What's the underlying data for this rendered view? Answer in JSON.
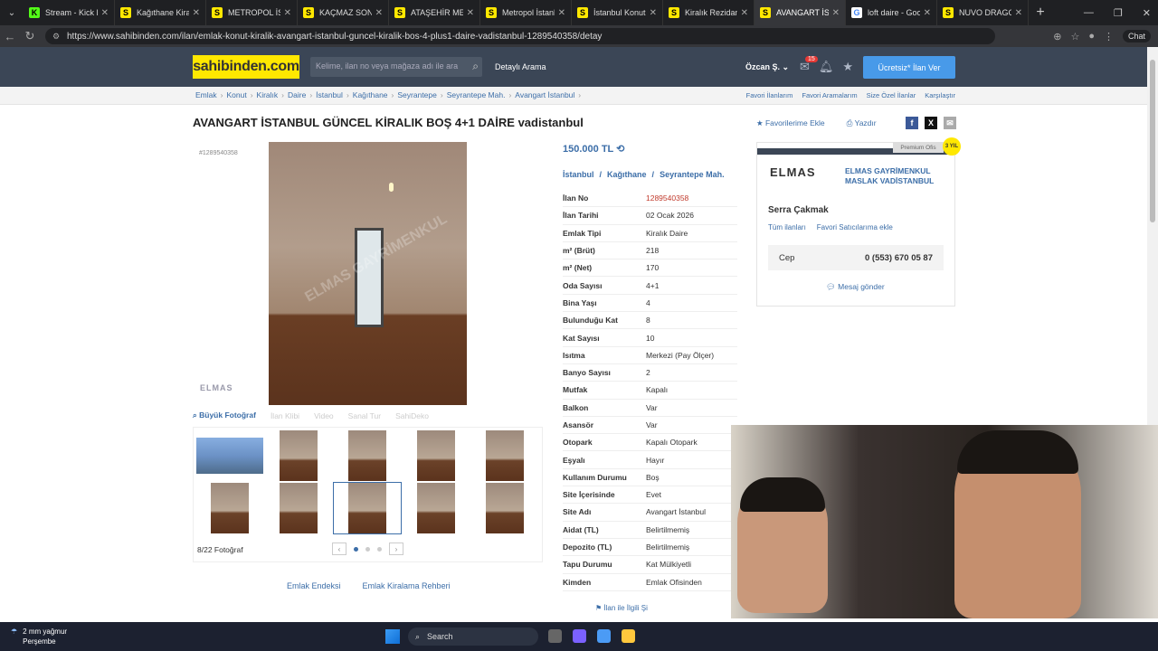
{
  "browser": {
    "tabs": [
      {
        "label": "Stream - Kick Das",
        "color": "#53fc18",
        "glyph": "K"
      },
      {
        "label": "Kağıthane Kiralık",
        "color": "#ffe800",
        "glyph": "S"
      },
      {
        "label": "METROPOL İSTAN",
        "color": "#ffe800",
        "glyph": "S"
      },
      {
        "label": "KAÇMAZ SON FIR",
        "color": "#ffe800",
        "glyph": "S"
      },
      {
        "label": "ATAŞEHİR METRO",
        "color": "#ffe800",
        "glyph": "S"
      },
      {
        "label": "Metropol İstanbu",
        "color": "#ffe800",
        "glyph": "S"
      },
      {
        "label": "İstanbul Konut Fiy",
        "color": "#ffe800",
        "glyph": "S"
      },
      {
        "label": "Kiralık Rezidans, V",
        "color": "#ffe800",
        "glyph": "S"
      },
      {
        "label": "AVANGART İSTAN",
        "color": "#ffe800",
        "glyph": "S",
        "active": true
      },
      {
        "label": "loft daire - Googl",
        "color": "#ffffff",
        "glyph": "G"
      },
      {
        "label": "NUVO DRAGOS S",
        "color": "#ffe800",
        "glyph": "S"
      }
    ],
    "url": "https://www.sahibinden.com/ilan/emlak-konut-kiralik-avangart-istanbul-guncel-kiralik-bos-4-plus1-daire-vadistanbul-1289540358/detay",
    "chat_label": "Chat"
  },
  "header": {
    "logo": "sahibinden.com",
    "search_placeholder": "Kelime, ilan no veya mağaza adı ile ara",
    "detailed_search": "Detaylı Arama",
    "user": "Özcan Ş.",
    "message_badge": "15",
    "cta": "Ücretsiz* İlan Ver"
  },
  "breadcrumb": [
    "Emlak",
    "Konut",
    "Kiralık",
    "Daire",
    "İstanbul",
    "Kağıthane",
    "Seyrantepe",
    "Seyrantepe Mah.",
    "Avangart İstanbul"
  ],
  "breadcrumb_links": [
    "Favori İlanlarım",
    "Favori Aramalarım",
    "Size Özel İlanlar",
    "Karşılaştır"
  ],
  "listing": {
    "title": "AVANGART İSTANBUL GÜNCEL KİRALIK BOŞ 4+1 DAİRE vadistanbul",
    "favorite_label": "Favorilerime Ekle",
    "print_label": "Yazdır",
    "id_tag": "#1289540358",
    "watermark": "ELMAS GAYRİMENKUL",
    "small_logo": "ELMAS",
    "media_tabs": [
      "Büyük Fotoğraf",
      "İlan Klibi",
      "Video",
      "Sanal Tur",
      "SahiDeko"
    ],
    "photo_count": "8/22 Fotoğraf",
    "bottom_links": [
      "Emlak Endeksi",
      "Emlak Kiralama Rehberi"
    ],
    "price": "150.000 TL",
    "location": [
      "İstanbul",
      "/",
      "Kağıthane",
      "/",
      "Seyrantepe Mah."
    ],
    "details": [
      {
        "k": "İlan No",
        "v": "1289540358"
      },
      {
        "k": "İlan Tarihi",
        "v": "02 Ocak 2026"
      },
      {
        "k": "Emlak Tipi",
        "v": "Kiralık Daire"
      },
      {
        "k": "m² (Brüt)",
        "v": "218"
      },
      {
        "k": "m² (Net)",
        "v": "170"
      },
      {
        "k": "Oda Sayısı",
        "v": "4+1"
      },
      {
        "k": "Bina Yaşı",
        "v": "4"
      },
      {
        "k": "Bulunduğu Kat",
        "v": "8"
      },
      {
        "k": "Kat Sayısı",
        "v": "10"
      },
      {
        "k": "Isıtma",
        "v": "Merkezi (Pay Ölçer)"
      },
      {
        "k": "Banyo Sayısı",
        "v": "2"
      },
      {
        "k": "Mutfak",
        "v": "Kapalı"
      },
      {
        "k": "Balkon",
        "v": "Var"
      },
      {
        "k": "Asansör",
        "v": "Var"
      },
      {
        "k": "Otopark",
        "v": "Kapalı Otopark"
      },
      {
        "k": "Eşyalı",
        "v": "Hayır"
      },
      {
        "k": "Kullanım Durumu",
        "v": "Boş"
      },
      {
        "k": "Site İçerisinde",
        "v": "Evet"
      },
      {
        "k": "Site Adı",
        "v": "Avangart İstanbul"
      },
      {
        "k": "Aidat (TL)",
        "v": "Belirtilmemiş"
      },
      {
        "k": "Depozito (TL)",
        "v": "Belirtilmemiş"
      },
      {
        "k": "Tapu Durumu",
        "v": "Kat Mülkiyetli"
      },
      {
        "k": "Kimden",
        "v": "Emlak Ofisinden"
      }
    ],
    "report_label": "İlan ile İlgili Şi"
  },
  "seller": {
    "premium": "Premium Ofis",
    "years": "3 YIL",
    "logo": "ELMAS",
    "name": "ELMAS GAYRİMENKUL MASLAK VADİSTANBUL",
    "person": "Serra Çakmak",
    "all_listings": "Tüm ilanları",
    "add_fav": "Favori Satıcılarıma ekle",
    "phone_label": "Cep",
    "phone": "0 (553) 670 05 87",
    "message": "Mesaj gönder"
  },
  "taskbar": {
    "weather_line1": "2 mm yağmur",
    "weather_line2": "Perşembe",
    "search": "Search"
  }
}
